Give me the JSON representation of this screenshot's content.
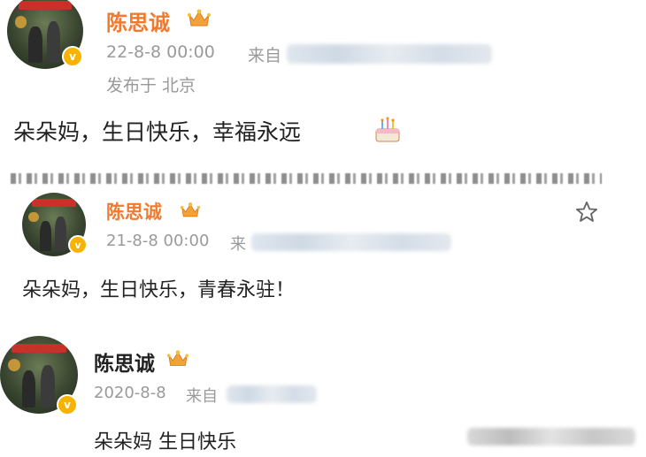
{
  "posts": [
    {
      "author": "陈思诚",
      "time": "22-8-8 00:00",
      "source_prefix": "来自",
      "location": "发布于 北京",
      "content": "朵朵妈，生日快乐，幸福永远"
    },
    {
      "author": "陈思诚",
      "time": "21-8-8 00:00",
      "source_prefix": "来",
      "content": "朵朵妈，生日快乐，青春永驻！"
    },
    {
      "author": "陈思诚",
      "time": "2020-8-8",
      "source_prefix": "来自",
      "content": "朵朵妈 生日快乐"
    }
  ],
  "colors": {
    "name_accent": "#f07a2e",
    "meta_gray": "#9a9a9a",
    "verified_badge": "#f6b400"
  },
  "icons": [
    "verified-badge-icon",
    "crown-icon",
    "cake-emoji-icon",
    "star-favorite-icon"
  ]
}
